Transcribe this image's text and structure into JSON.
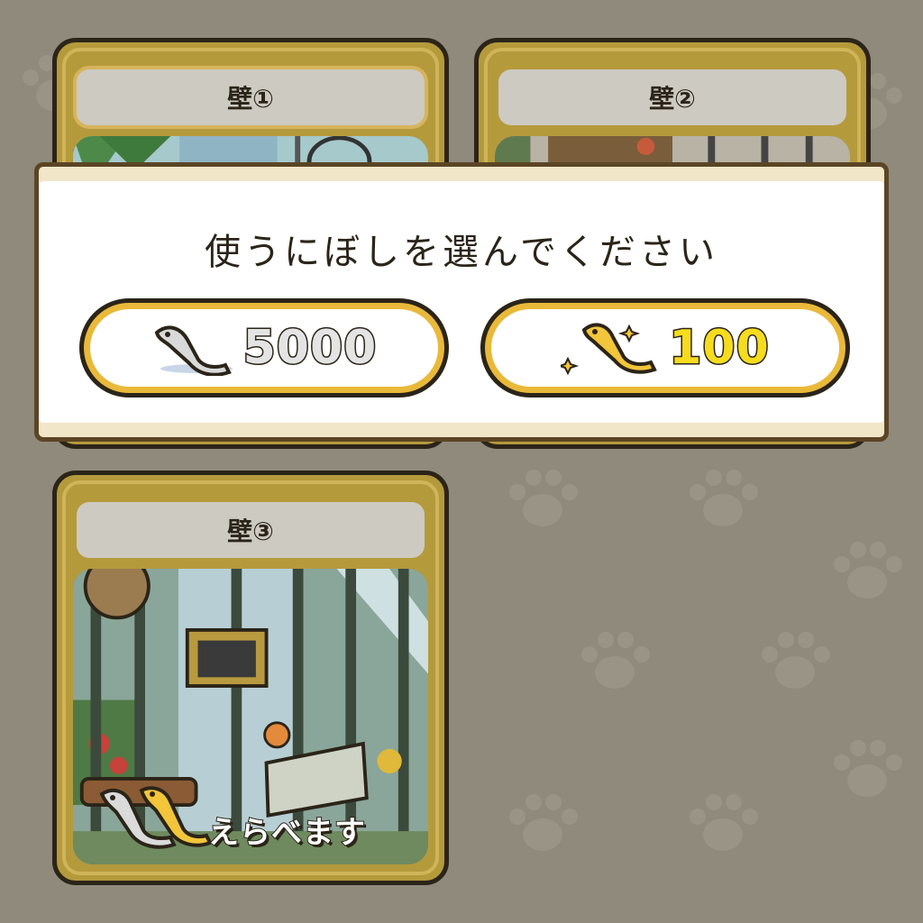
{
  "colors": {
    "background": "#8f8a7c",
    "card_frame": "#b59a3c",
    "dialog_border": "#5b4525",
    "choice_border": "#e9b93a",
    "silver_amount": "#e4e4e4",
    "gold_amount": "#f5dc1e"
  },
  "cards": [
    {
      "title": "壁①"
    },
    {
      "title": "壁②"
    },
    {
      "title": "壁③",
      "badge": "えらべます",
      "badge_icon": "silver-and-gold-fish-icon"
    }
  ],
  "dialog": {
    "title": "使うにぼしを選んでください",
    "options": [
      {
        "amount": "5000",
        "icon": "silver-fish-icon"
      },
      {
        "amount": "100",
        "icon": "gold-fish-icon"
      }
    ]
  }
}
